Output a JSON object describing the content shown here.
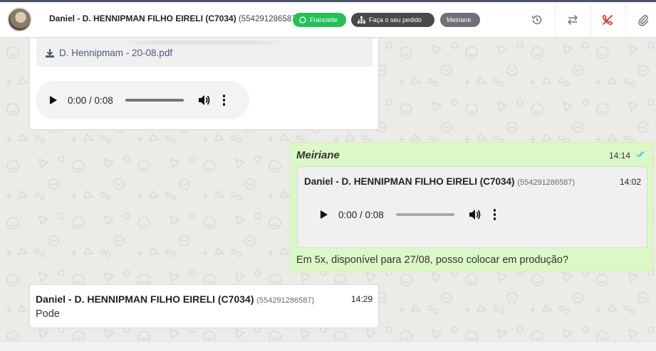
{
  "header": {
    "contact_name": "Daniel - D. HENNIPMAN FILHO EIRELI (C7034)",
    "contact_phone": "(554291286587)",
    "tags": [
      {
        "label": "Francielle",
        "icon": "whatsapp-icon",
        "color": "#25c05a"
      },
      {
        "label": "Faça o seu pedido",
        "icon": "sitemap-icon",
        "color": "#4a4a4a"
      },
      {
        "label": "Meiriane",
        "icon": "",
        "color": "#6e7177"
      }
    ],
    "actions": [
      "history-icon",
      "transfer-icon",
      "end-call-icon",
      "attach-icon"
    ]
  },
  "messages": {
    "first": {
      "file_name": "D. Hennipmam - 20-08.pdf",
      "audio_time": "0:00 / 0:08"
    },
    "reply": {
      "sender": "Meiriane",
      "time": "14:14",
      "quoted_name": "Daniel - D. HENNIPMAN FILHO EIRELI (C7034)",
      "quoted_phone": "(554291286587)",
      "quoted_time": "14:02",
      "quoted_audio_time": "0:00 / 0:08",
      "text": "Em 5x, disponível para 27/08, posso colocar em produção?"
    },
    "last": {
      "sender_name": "Daniel - D. HENNIPMAN FILHO EIRELI (C7034)",
      "sender_phone": "(554291286587)",
      "time": "14:29",
      "text": "Pode"
    }
  },
  "colors": {
    "outgoing_bubble": "#dcf8c6",
    "read_ticks": "#4fc3f7",
    "end_call": "#d32f2f"
  }
}
